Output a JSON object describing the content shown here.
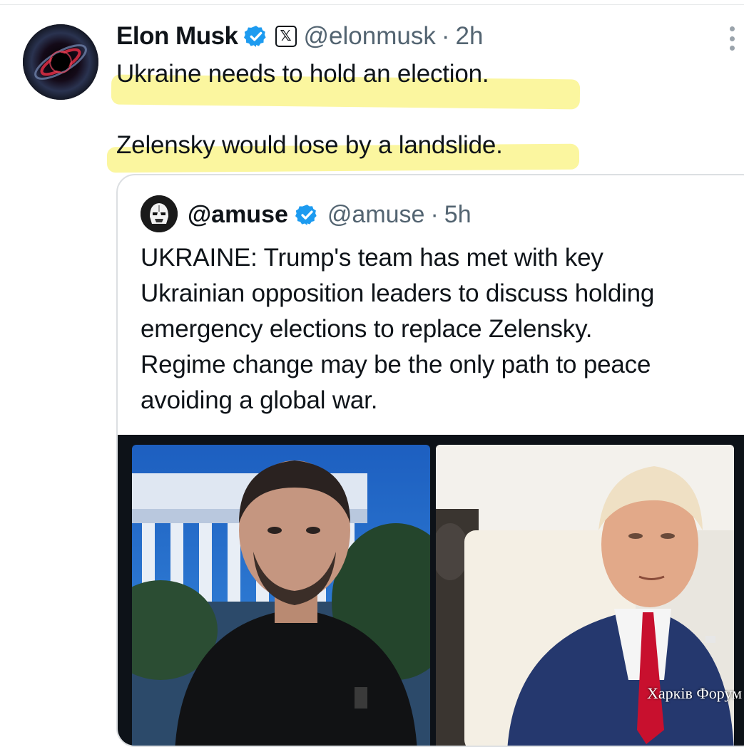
{
  "post": {
    "author_name": "Elon Musk",
    "handle": "@elonmusk",
    "separator": "·",
    "time": "2h",
    "lines": [
      "Ukraine needs to hold an election.",
      "Zelensky would lose by a landslide."
    ],
    "highlight_color": "#fbf59a"
  },
  "quoted_post": {
    "author_name": "@amuse",
    "handle": "@amuse",
    "separator": "·",
    "time": "5h",
    "lines": [
      "UKRAINE: Trump's team has met with key",
      "Ukrainian opposition leaders to discuss holding",
      "emergency elections to replace Zelensky.",
      "Regime change may be the only path to peace",
      "avoiding a global war."
    ],
    "media": {
      "watermark": "Харків Форум"
    }
  },
  "icons": {
    "verified": "verified-badge-icon",
    "platform": "x-logo-icon",
    "more": "more-options-icon"
  },
  "badges": {
    "x_letter": "𝕏"
  },
  "colors": {
    "verified_blue": "#1d9bf0",
    "secondary_text": "#536471",
    "border": "#dcdfe2"
  }
}
